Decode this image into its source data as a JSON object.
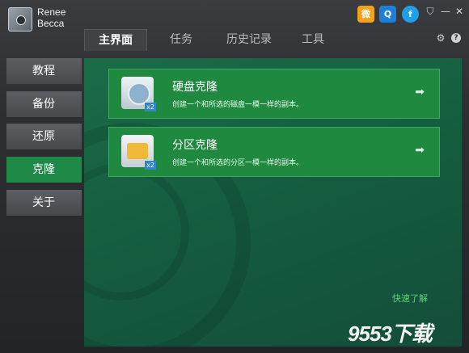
{
  "app": {
    "name_line1": "Renee",
    "name_line2": "Becca"
  },
  "titlebar": {
    "social": [
      {
        "icon": "weibo-icon",
        "glyph": "微"
      },
      {
        "icon": "qq-icon",
        "glyph": "Q"
      },
      {
        "icon": "facebook-icon",
        "glyph": "f"
      }
    ],
    "tshirt_glyph": "⛉",
    "minimize_glyph": "—",
    "close_glyph": "✕",
    "settings_glyph": "⚙",
    "help_glyph": "?"
  },
  "tabs": [
    {
      "label": "主界面",
      "active": true
    },
    {
      "label": "任务",
      "active": false
    },
    {
      "label": "历史记录",
      "active": false
    },
    {
      "label": "工具",
      "active": false
    }
  ],
  "sidebar": [
    {
      "label": "教程",
      "active": false
    },
    {
      "label": "备份",
      "active": false
    },
    {
      "label": "还原",
      "active": false
    },
    {
      "label": "克隆",
      "active": true
    },
    {
      "label": "关于",
      "active": false
    }
  ],
  "cards": [
    {
      "title": "硬盘克隆",
      "description": "创建一个和所选的磁盘一模一样的副本。",
      "badge": "x2",
      "arrow": "➡"
    },
    {
      "title": "分区克隆",
      "description": "创建一个和所选的分区一模一样的副本。",
      "badge": "x2",
      "arrow": "➡"
    }
  ],
  "quick_link": "快速了解",
  "watermark": "9553下载",
  "colors": {
    "accent_green": "#1f8a3f",
    "panel_green": "#155c3f",
    "link_green": "#62d07a"
  }
}
